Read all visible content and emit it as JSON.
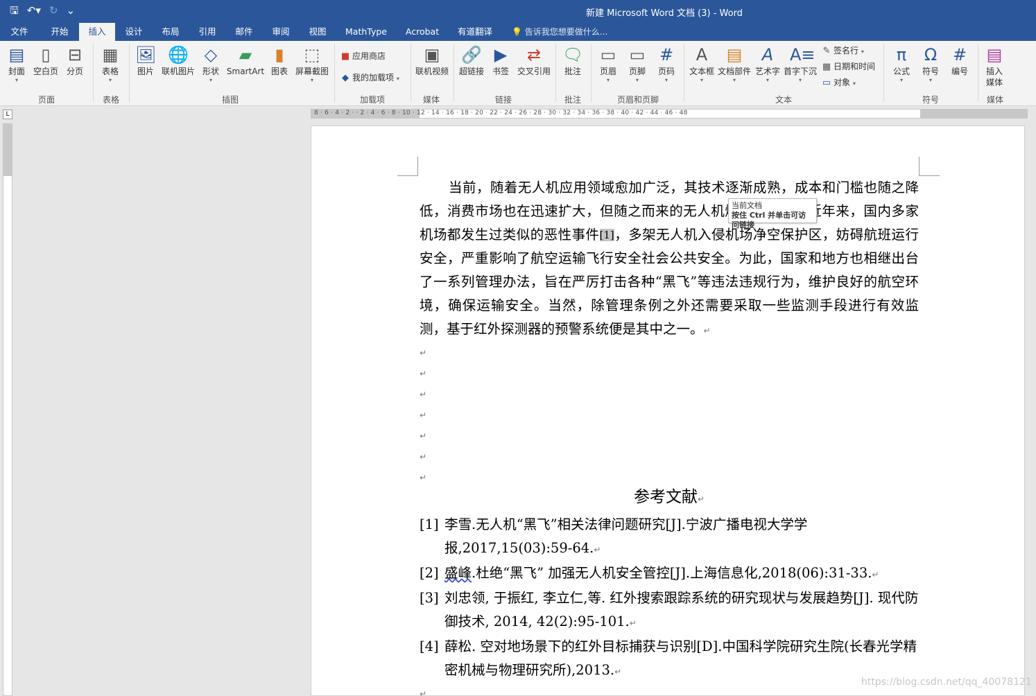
{
  "window": {
    "title": "新建 Microsoft Word 文档 (3) - Word"
  },
  "qat": {
    "save": "🖫",
    "undo": "↶▾",
    "redo": "↻",
    "more": "⌄"
  },
  "tabs": [
    "文件",
    "开始",
    "插入",
    "设计",
    "布局",
    "引用",
    "邮件",
    "审阅",
    "视图",
    "MathType",
    "Acrobat",
    "有道翻译"
  ],
  "active_tab": "插入",
  "tell_me": "💡 告诉我您想要做什么...",
  "ribbon": {
    "buttons": [
      "封面",
      "空白页",
      "分页",
      "表格",
      "图片",
      "联机图片",
      "形状",
      "SmartArt",
      "图表",
      "屏幕截图",
      "联机视频",
      "超链接",
      "书签",
      "交叉引用",
      "批注",
      "页眉",
      "页脚",
      "页码",
      "文本框",
      "文档部件",
      "艺术字",
      "首字下沉",
      "公式",
      "符号",
      "编号",
      "插入",
      "媒体"
    ],
    "small": [
      "应用商店",
      "我的加载项",
      "签名行",
      "日期和时间",
      "对象"
    ],
    "groups": [
      "页面",
      "表格",
      "插图",
      "加载项",
      "媒体",
      "链接",
      "批注",
      "页眉和页脚",
      "文本",
      "符号",
      "媒体"
    ]
  },
  "ruler": {
    "h": "8 · 6 · 4 · 2 ·  · 2 · 4 · 6 · 8 · 10 · 12 · 14 · 16 · 18 · 20 · 22 · 24 · 26 · 28 · 30 · 32 · 34 · 36 · 38 · 40 · 42 · 44 · 46 · 48",
    "corner": "L"
  },
  "document": {
    "para_a": "当前，随着无人机应用领域愈加广泛，其技术逐渐成熟，成本和门槛也随之降低，消费市场也在迅速扩大，但随之而来的无人机",
    "para_b": "爆发式增长。近年来，国内多家机场都发生过类似的恶性事件",
    "citation": "[1]",
    "para_c": "，多架无人机入侵机场净空保护区，妨碍航班运行安全，严重影响了航空运输飞行安全社会公共安全。为此，国家和地方也相继出台了一系列管理办法，旨在严厉打击各种“黑飞”等违法违规行为，维护良好的航空环境，确保运输安全。当然，除管理条例之外还需要采取一些监测手段进行有效监测，基于红外探测器的预警系统便是其中之一。",
    "para_mark": "↵",
    "heading": "参考文献",
    "tooltip_line1": "当前文档",
    "tooltip_line2": "按住 Ctrl 并单击可访问链接",
    "refs": [
      {
        "num": "[1]",
        "text": "李雪.无人机“黑飞”相关法律问题研究[J].宁波广播电视大学学报,2017,15(03):59-64."
      },
      {
        "num": "[2]",
        "pre": "盛峰",
        "text": ".杜绝“黑飞”  加强无人机安全管控[J].上海信息化,2018(06):31-33."
      },
      {
        "num": "[3]",
        "text": "刘忠领, 于振红, 李立仁,等. 红外搜索跟踪系统的研究现状与发展趋势[J]. 现代防御技术, 2014, 42(2):95-101."
      },
      {
        "num": "[4]",
        "text": "薛松. 空对地场景下的红外目标捕获与识别[D].中国科学院研究生院(长春光学精密机械与物理研究所),2013."
      }
    ]
  },
  "watermark": "https://blog.csdn.net/qq_40078121"
}
